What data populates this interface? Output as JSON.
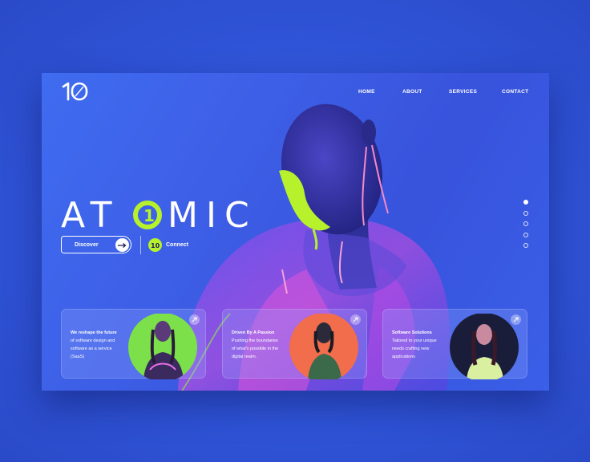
{
  "brand": {
    "logo_text": "10"
  },
  "nav": {
    "items": [
      {
        "label": "HOME"
      },
      {
        "label": "ABOUT"
      },
      {
        "label": "SERVICES"
      },
      {
        "label": "CONTACT"
      }
    ]
  },
  "hero": {
    "title_pre": "AT",
    "title_o_glyph": "1",
    "title_post": "MIC",
    "discover_label": "Discover",
    "connect_label": "Connect",
    "connect_badge": "10"
  },
  "slider": {
    "count": 5,
    "active_index": 0
  },
  "cards": [
    {
      "title": "We reshape the future",
      "lines": [
        "of software design and",
        "software as a service",
        "(SaaS)"
      ],
      "circle_color": "#7be04a"
    },
    {
      "title": "Driven By A  Passion",
      "lines": [
        "Pushing the boundaries",
        "of what's possible in the",
        "digital realm."
      ],
      "circle_color": "#f26d4b"
    },
    {
      "title": "Software Solutions",
      "lines": [
        "Tailored to your unique",
        "needs crafting new",
        "applications"
      ],
      "circle_color": "#1a1d3a"
    }
  ],
  "colors": {
    "accent": "#b6f12c",
    "magenta": "#e03cd8",
    "background": "#3a63e6"
  }
}
